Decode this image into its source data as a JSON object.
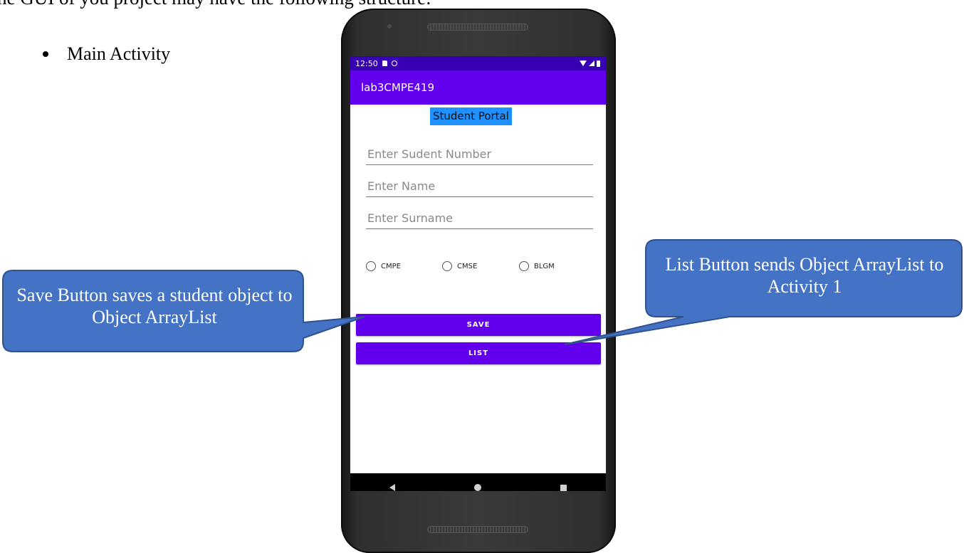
{
  "document": {
    "heading": "he GUI of you project may have the following structure:",
    "bullet": "Main Activity"
  },
  "phone": {
    "status_bar": {
      "time": "12:50",
      "icons_left": [
        "sd-card-icon",
        "sync-icon"
      ],
      "icons_right": [
        "wifi-icon",
        "signal-icon",
        "battery-icon"
      ]
    },
    "app_bar": {
      "title": "lab3CMPE419"
    },
    "portal_title": "Student Portal",
    "fields": {
      "student_number_placeholder": "Enter Sudent Number",
      "name_placeholder": "Enter Name",
      "surname_placeholder": "Enter Surname"
    },
    "radio_options": [
      "CMPE",
      "CMSE",
      "BLGM"
    ],
    "buttons": {
      "save": "SAVE",
      "list": "LIST"
    },
    "nav_bar": [
      "back-icon",
      "home-icon",
      "recents-icon"
    ]
  },
  "callouts": {
    "save": "Save Button saves a student object to Object ArrayList",
    "list": "List Button sends Object ArrayList to Activity 1"
  },
  "colors": {
    "status_bar": "#3700b3",
    "primary": "#6200ee",
    "portal_highlight": "#1e90ff",
    "callout_fill": "#4472c4",
    "callout_border": "#2f528f"
  }
}
